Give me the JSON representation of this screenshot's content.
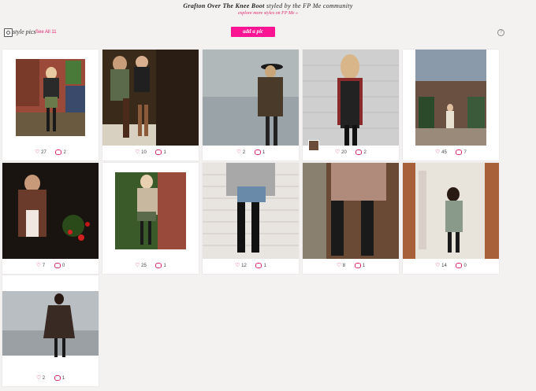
{
  "header": {
    "title_bold": "Grafton Over The Knee Boot",
    "title_rest": " styled by the FP Me community",
    "subtitle": "explore more styles on FP Me »"
  },
  "toolbar": {
    "style_pics": "style pics",
    "see_all": "See All 11",
    "add_pic": "add a pic",
    "help": "?"
  },
  "cards": [
    {
      "likes": "27",
      "comments": "2"
    },
    {
      "likes": "10",
      "comments": "1"
    },
    {
      "likes": "2",
      "comments": "1"
    },
    {
      "likes": "20",
      "comments": "2"
    },
    {
      "likes": "45",
      "comments": "7"
    },
    {
      "likes": "7",
      "comments": "0"
    },
    {
      "likes": "25",
      "comments": "1"
    },
    {
      "likes": "12",
      "comments": "1"
    },
    {
      "likes": "8",
      "comments": "1"
    },
    {
      "likes": "14",
      "comments": "0"
    },
    {
      "likes": "2",
      "comments": "1"
    }
  ]
}
